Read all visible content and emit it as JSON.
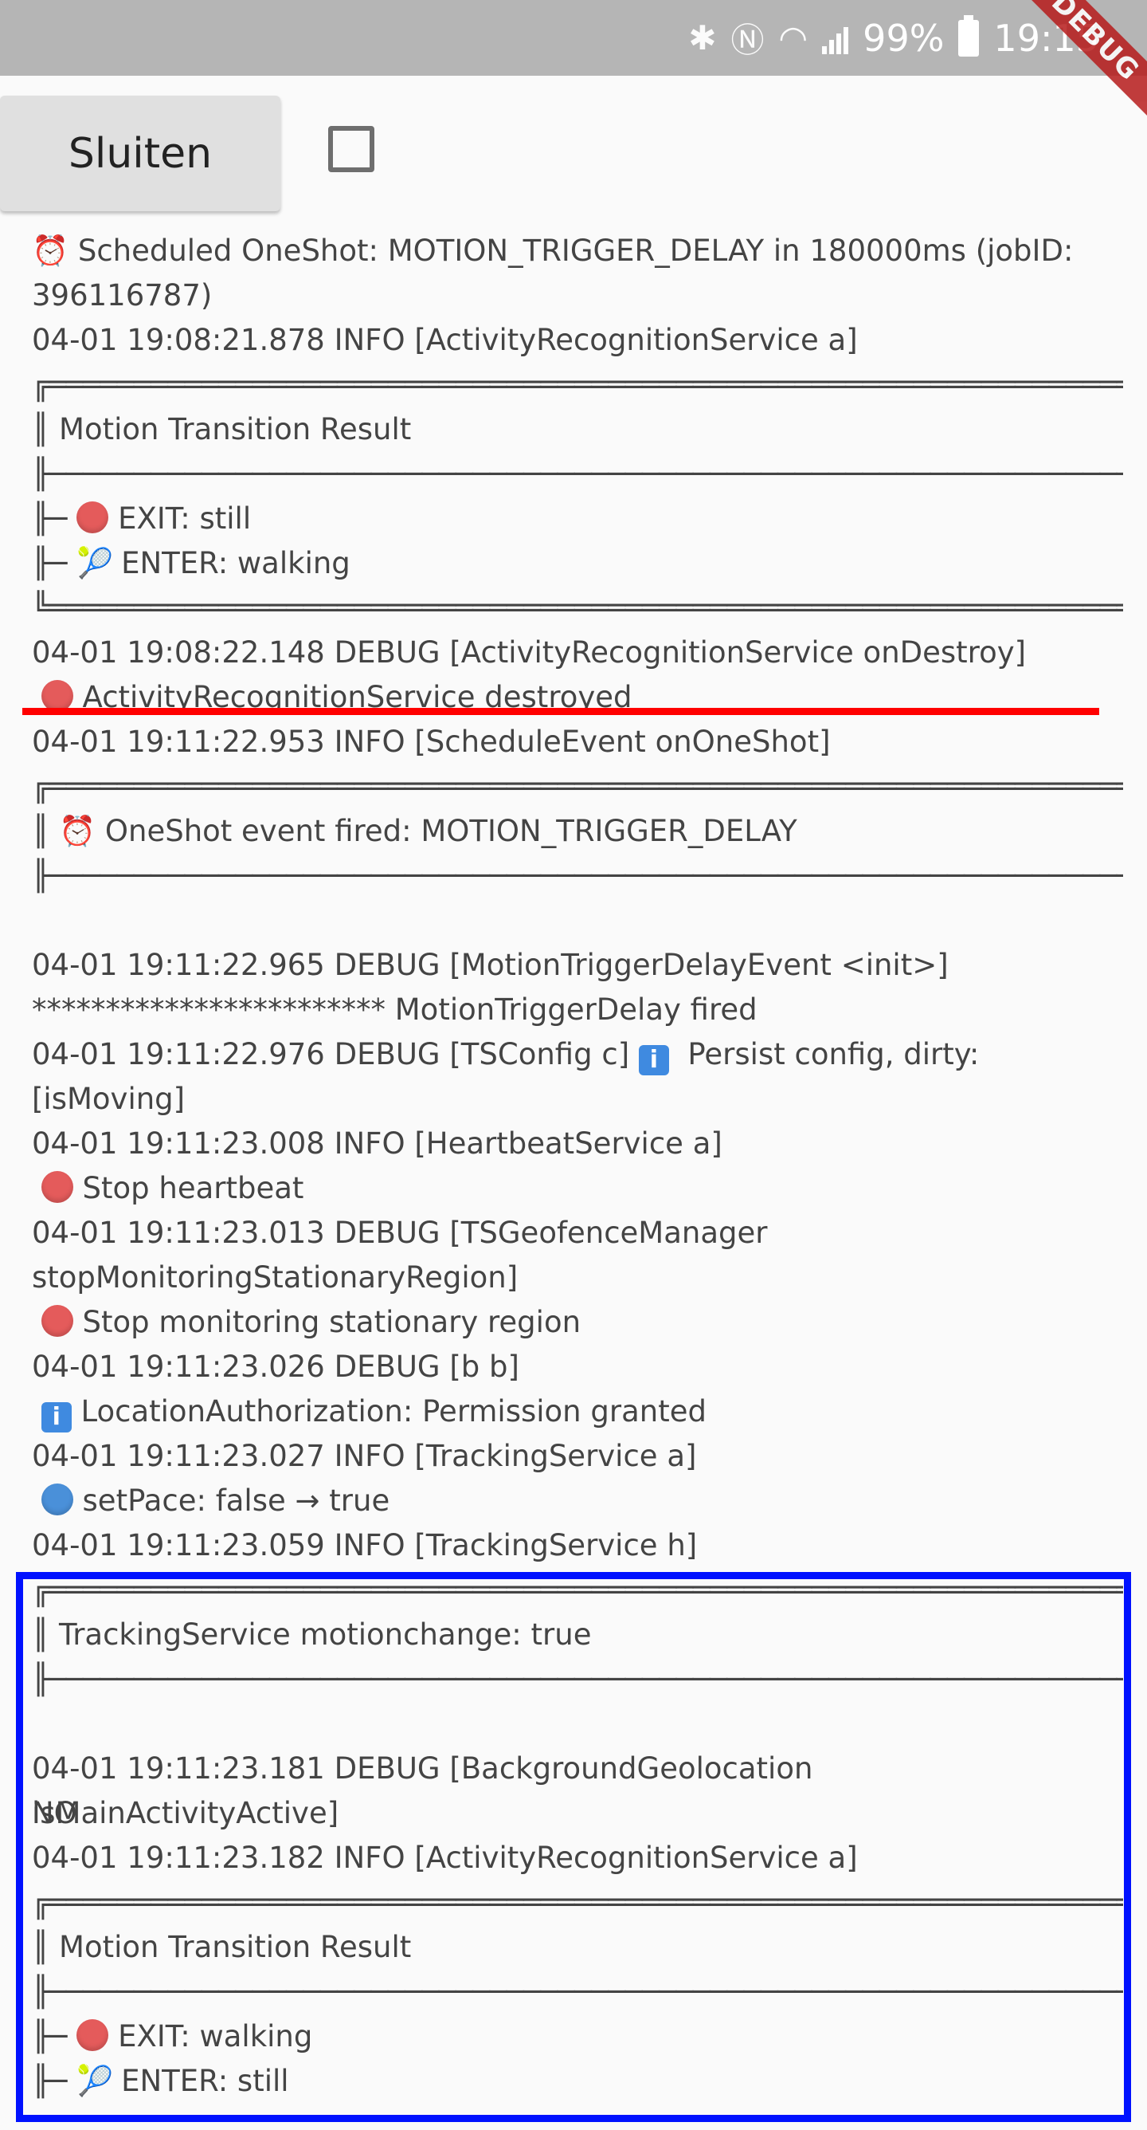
{
  "status_bar": {
    "battery": "99%",
    "time": "19:15",
    "debug_banner": "DEBUG",
    "icons": [
      "bluetooth-icon",
      "nfc-icon",
      "wifi-icon",
      "signal-icon",
      "battery-icon"
    ]
  },
  "toolbar": {
    "close_label": "Sluiten",
    "checkbox_checked": false
  },
  "log": {
    "l1": "⏰ Scheduled OneShot: MOTION_TRIGGER_DELAY in 180000ms (jobID:",
    "l2": "396116787)",
    "l3": "04-01 19:08:21.878 INFO [ActivityRecognitionService a]",
    "box_top": "╔═════════════════════════════════════════════════════════════════════",
    "box_mid": "╟─────────────────────────────────────────────────────────────────────",
    "box_bot": "╚═════════════════════════════════════════════════════════════════════",
    "l4": "║ Motion Transition Result",
    "l5_prefix": "╟─ ",
    "l5": " EXIT: still",
    "l6_prefix": "╟─ ",
    "l6": " ENTER: walking",
    "l7": "04-01 19:08:22.148 DEBUG [ActivityRecognitionService onDestroy]",
    "l8": " ActivityRecognitionService destroyed",
    "l9": "04-01 19:11:22.953 INFO [ScheduleEvent onOneShot]",
    "l10": "║ ⏰ OneShot event fired: MOTION_TRIGGER_DELAY",
    "l11": "04-01 19:11:22.965 DEBUG [MotionTriggerDelayEvent <init>]",
    "l12": "************************ MotionTriggerDelay fired",
    "l13a": "04-01 19:11:22.976 DEBUG [TSConfig c] ",
    "l13b": "  Persist config, dirty:",
    "l14": "[isMoving]",
    "l15": "04-01 19:11:23.008 INFO [HeartbeatService a]",
    "l16": " Stop heartbeat",
    "l17": "04-01 19:11:23.013 DEBUG [TSGeofenceManager",
    "l18": "stopMonitoringStationaryRegion]",
    "l19": " Stop monitoring stationary region",
    "l20": "04-01 19:11:23.026 DEBUG [b b]",
    "l21": " LocationAuthorization: Permission granted",
    "l22": "04-01 19:11:23.027 INFO [TrackingService a]",
    "l23": " setPace: false → true",
    "l24": "04-01 19:11:23.059 INFO [TrackingService h]",
    "l25": "║ TrackingService motionchange: true",
    "l26": "04-01 19:11:23.181 DEBUG [BackgroundGeolocation isMainActivityActive]",
    "l27": "NO",
    "l28": "04-01 19:11:23.182 INFO [ActivityRecognitionService a]",
    "l29": "║ Motion Transition Result",
    "l30": " EXIT: walking",
    "l31": " ENTER: still"
  },
  "colors": {
    "highlight_underline": "#ff0000",
    "highlight_box": "#0011ff",
    "status_bar_bg": "#b5b5b5"
  }
}
